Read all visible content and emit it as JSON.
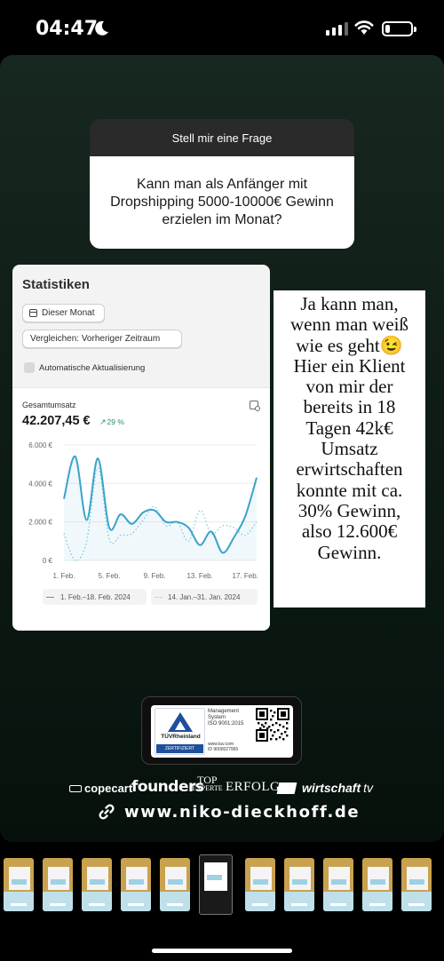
{
  "status_bar": {
    "time": "04:47",
    "focus_icon": "moon-icon",
    "signal_icon": "cellular-signal-icon",
    "wifi_icon": "wifi-icon",
    "battery_icon": "battery-icon",
    "battery_level": 0.2
  },
  "question_sticker": {
    "header": "Stell mir eine Frage",
    "question": "Kann man als Anfänger mit Dropshipping 5000-10000€ Gewinn erzielen im Monat?"
  },
  "stats_card": {
    "title": "Statistiken",
    "date_button": "Dieser Monat",
    "compare_button": "Vergleichen: Vorheriger Zeitraum",
    "auto_refresh_label": "Automatische Aktualisierung",
    "metric_label": "Gesamtumsatz",
    "metric_value": "42.207,45 €",
    "metric_change": "29 %",
    "accent_color": "#3aa3c9",
    "compare_color": "#8ccfe0",
    "delta_color": "#2a8a72"
  },
  "chart_data": {
    "type": "line",
    "ylim": [
      0,
      6000
    ],
    "y_ticks": [
      "6.000 €",
      "4.000 €",
      "2.000 €",
      "0 €"
    ],
    "x_ticks": [
      "1. Feb.",
      "5. Feb.",
      "9. Feb.",
      "13. Feb.",
      "17. Feb."
    ],
    "grid": true,
    "series": [
      {
        "name": "1. Feb.–18. Feb. 2024",
        "style": "solid",
        "x": [
          1,
          2,
          3,
          4,
          5,
          6,
          7,
          8,
          9,
          10,
          11,
          12,
          13,
          14,
          15,
          16,
          17,
          18
        ],
        "values": [
          3200,
          5400,
          2100,
          5300,
          1700,
          2400,
          1900,
          2500,
          2600,
          2000,
          2000,
          1700,
          800,
          1500,
          400,
          1200,
          2300,
          4300
        ]
      },
      {
        "name": "14. Jan.–31. Jan. 2024",
        "style": "dotted",
        "x": [
          1,
          2,
          3,
          4,
          5,
          6,
          7,
          8,
          9,
          10,
          11,
          12,
          13,
          14,
          15,
          16,
          17,
          18
        ],
        "values": [
          1400,
          0,
          1000,
          4800,
          1100,
          1300,
          1400,
          2100,
          2800,
          1800,
          2000,
          1000,
          2600,
          1400,
          1800,
          1700,
          1300,
          2000
        ]
      }
    ],
    "legend": [
      "1. Feb.–18. Feb. 2024",
      "14. Jan.–31. Jan. 2024"
    ],
    "legend_placement": "bottom"
  },
  "caption": "Ja kann man,\nwenn man weiß\nwie es geht😉\nHier ein Klient\nvon mir der\nbereits in 18\nTagen 42k€\nUmsatz\nerwirtschaften\nkonnte mit ca.\n30% Gewinn,\nalso 12.600€\nGewinn.",
  "tuv_badge": {
    "brand": "TÜVRheinland",
    "certified": "ZERTIFIZIERT",
    "system_line1": "Management",
    "system_line2": "System",
    "standard": "ISO 9001:2015",
    "site": "www.tuv.com",
    "id": "ID 9000027965"
  },
  "press_logos": {
    "copecart": "copecart",
    "founders": "founders",
    "top_line1": "TOP",
    "top_line2": "EXPERTE",
    "erfolg": "ERFOLG",
    "wirtschaft": "wirtschaft",
    "tv": "tv"
  },
  "website": "www.niko-dieckhoff.de",
  "thumbnails": {
    "count": 11,
    "active_index": 5
  }
}
